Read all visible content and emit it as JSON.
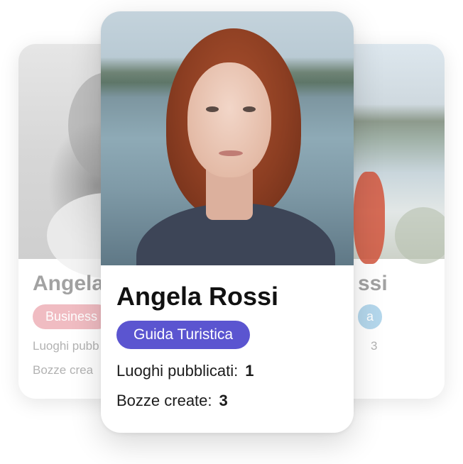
{
  "cards": {
    "back_left": {
      "name": "Angela",
      "badge": "Business",
      "stat_published_label": "Luoghi pubb",
      "stat_drafts_label": "Bozze crea"
    },
    "back_right": {
      "name": "ssi",
      "badge": "a",
      "stat_published_value": "3"
    },
    "front": {
      "name": "Angela Rossi",
      "badge": "Guida Turistica",
      "stat_published_label": "Luoghi pubblicati:",
      "stat_published_value": "1",
      "stat_drafts_label": "Bozze create:",
      "stat_drafts_value": "3"
    }
  },
  "colors": {
    "front_badge": "#5b55d0",
    "left_badge": "#e06d7a",
    "right_badge": "#5aa8d6"
  }
}
